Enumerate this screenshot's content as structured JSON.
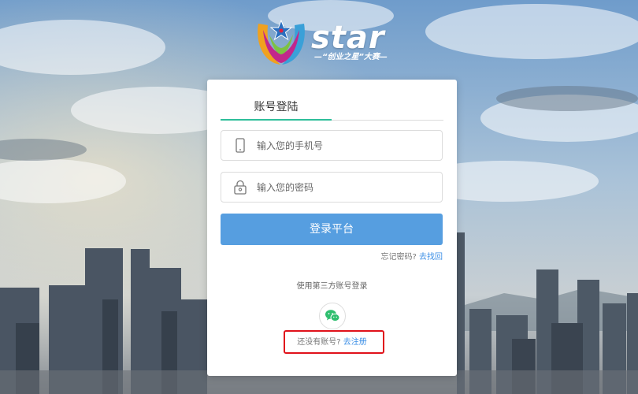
{
  "logo": {
    "text": "star",
    "subtitle": "—“创业之星”大赛—"
  },
  "login": {
    "tab_label": "账号登陆",
    "phone_placeholder": "输入您的手机号",
    "password_placeholder": "输入您的密码",
    "submit_label": "登录平台",
    "forgot_text": "忘记密码?",
    "forgot_link": "去找回",
    "third_party_label": "使用第三方账号登录",
    "no_account_text": "还没有账号?",
    "register_link": "去注册"
  },
  "colors": {
    "accent_green": "#2ebe9a",
    "button_blue": "#569ee0",
    "link_blue": "#3a8ee6",
    "highlight_red": "#e0121b"
  },
  "icons": {
    "phone": "phone-icon",
    "lock": "lock-icon",
    "wechat": "wechat-icon"
  }
}
